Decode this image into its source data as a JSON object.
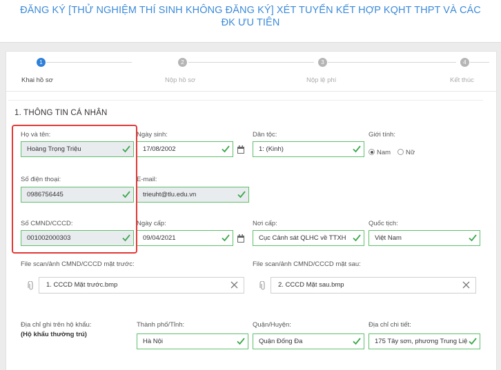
{
  "header": {
    "title": "ĐĂNG KÝ [THỬ NGHIỆM THÍ SINH KHÔNG ĐĂNG KÝ] XÉT TUYỂN KẾT HỢP KQHT THPT VÀ CÁC ĐK ƯU TIÊN"
  },
  "steps": [
    {
      "number": "1",
      "label": "Khai hồ sơ"
    },
    {
      "number": "2",
      "label": "Nộp hồ sơ"
    },
    {
      "number": "3",
      "label": "Nộp lệ phí"
    },
    {
      "number": "4",
      "label": "Kết thúc"
    }
  ],
  "section": {
    "title": "1. THÔNG TIN CÁ NHÂN"
  },
  "form": {
    "fullname": {
      "label": "Họ và tên:",
      "value": "Hoàng Trọng Triệu"
    },
    "dob": {
      "label": "Ngày sinh:",
      "value": "17/08/2002"
    },
    "ethnicity": {
      "label": "Dân tộc:",
      "value": "1: (Kinh)"
    },
    "gender": {
      "label": "Giới tính:",
      "options": [
        "Nam",
        "Nữ"
      ],
      "selected": "Nam"
    },
    "phone": {
      "label": "Số điện thoại:",
      "value": "0986756445"
    },
    "email": {
      "label": "E-mail:",
      "value": "trieuht@tlu.edu.vn"
    },
    "id_number": {
      "label": "Số CMND/CCCD:",
      "value": "001002000303"
    },
    "issue_date": {
      "label": "Ngày cấp:",
      "value": "09/04/2021"
    },
    "issue_place": {
      "label": "Nơi cấp:",
      "value": "Cục Cảnh sát QLHC về TTXH"
    },
    "nationality": {
      "label": "Quốc tịch:",
      "value": "Việt Nam"
    },
    "id_front": {
      "label": "File scan/ảnh CMND/CCCD mặt trước:",
      "value": "1. CCCD Mặt trước.bmp"
    },
    "id_back": {
      "label": "File scan/ảnh CMND/CCCD mặt sau:",
      "value": "2. CCCD Mặt sau.bmp"
    },
    "address": {
      "label": "Địa chỉ ghi trên hộ khẩu:",
      "sublabel": "(Hộ khẩu thường trú)"
    },
    "city": {
      "label": "Thành phố/Tỉnh:",
      "value": "Hà Nội"
    },
    "district": {
      "label": "Quận/Huyện:",
      "value": "Quận Đống Đa"
    },
    "detail": {
      "label": "Địa chỉ chi tiết:",
      "value": "175 Tây sơn, phương Trung Liệ"
    }
  },
  "colors": {
    "accent": "#2f80d9",
    "valid": "#5cbf6a",
    "highlight": "#e23636"
  }
}
